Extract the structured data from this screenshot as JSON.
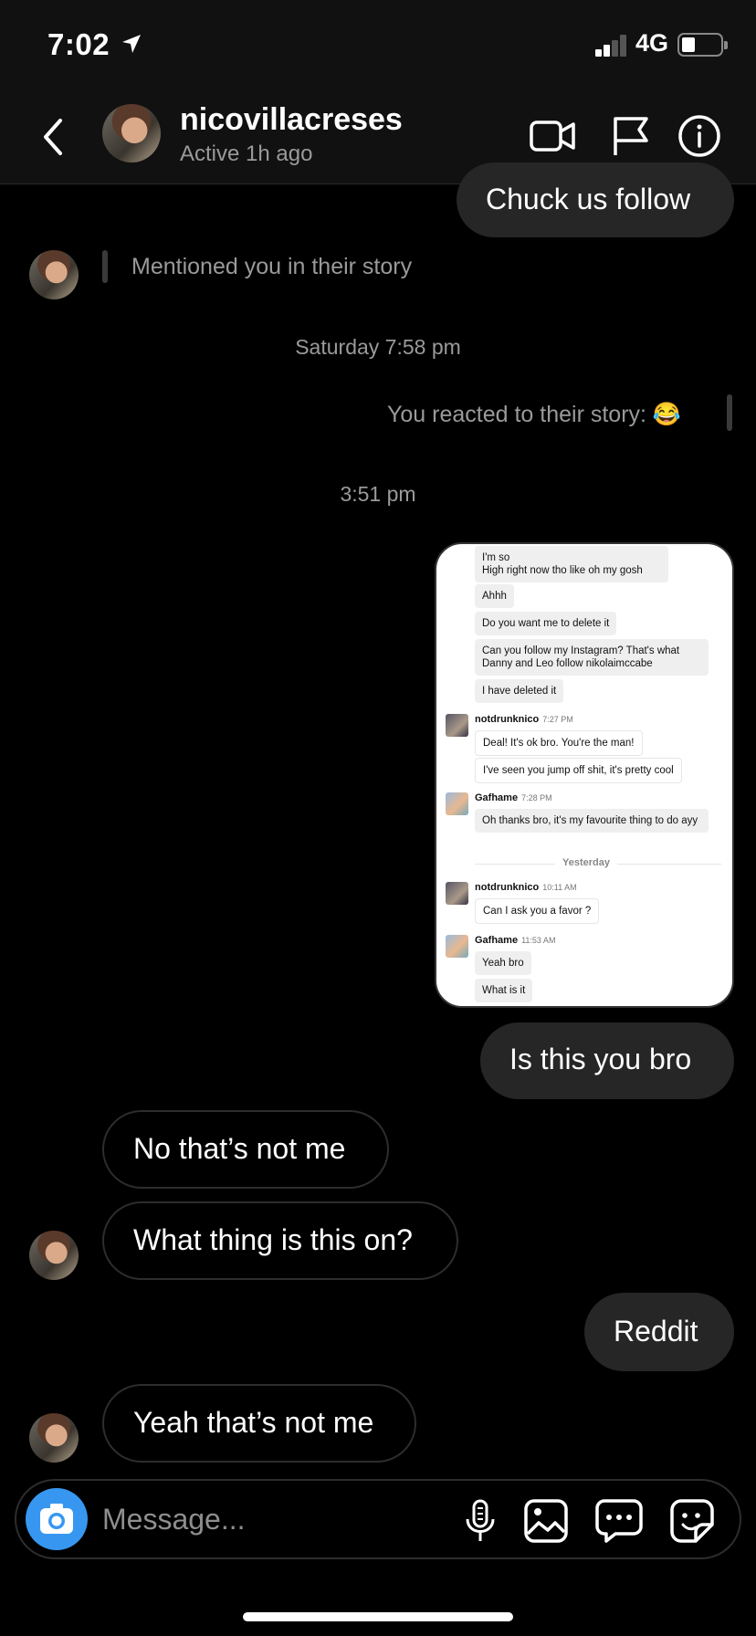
{
  "status_bar": {
    "time": "7:02",
    "network": "4G"
  },
  "header": {
    "username": "nicovillacreses",
    "active_status": "Active 1h ago"
  },
  "messages": {
    "sent_chuck": "Chuck us follow",
    "story_mention": "Mentioned you in their story",
    "time_saturday": "Saturday 7:58 pm",
    "reacted_story": "You reacted to their story: 😂",
    "time_351": "3:51 pm",
    "sent_is_this_you": "Is this you bro",
    "recv_not_me": "No that’s not me",
    "recv_what_thing": "What thing is this on?",
    "sent_reddit": "Reddit",
    "recv_yeah_not_me": "Yeah that’s not me"
  },
  "screenshot": {
    "msg1": "I'm so\nHigh right now tho like oh my gosh",
    "msg2": "Ahhh",
    "msg3": "Do you want me to delete it",
    "msg4": "Can you follow my Instagram? That's what Danny and Leo follow nikolaimccabe",
    "msg5": "I have deleted it",
    "user1_name": "notdrunknico",
    "user1_time1": "7:27 PM",
    "msg6": "Deal! It's ok bro. You're the man!",
    "msg7": "I've seen you jump off shit, it's pretty cool",
    "user2_name": "Gafhame",
    "user2_time1": "7:28 PM",
    "msg8": "Oh thanks bro, it's my favourite thing to do ayy",
    "divider": "Yesterday",
    "user1_time2": "10:11 AM",
    "msg9": "Can I ask you a favor ?",
    "user2_time2": "11:53 AM",
    "msg10": "Yeah bro",
    "msg11": "What is it"
  },
  "composer": {
    "placeholder": "Message..."
  },
  "icons": {
    "back": "chevron-left-icon",
    "video": "video-call-icon",
    "flag": "flag-icon",
    "info": "info-icon",
    "camera": "camera-icon",
    "mic": "microphone-icon",
    "gallery": "gallery-icon",
    "chat": "chat-bubble-icon",
    "sticker": "sticker-icon"
  },
  "colors": {
    "background": "#000000",
    "bubble_out": "#262626",
    "accent": "#3797f0",
    "secondary_text": "#9a9a9a"
  }
}
